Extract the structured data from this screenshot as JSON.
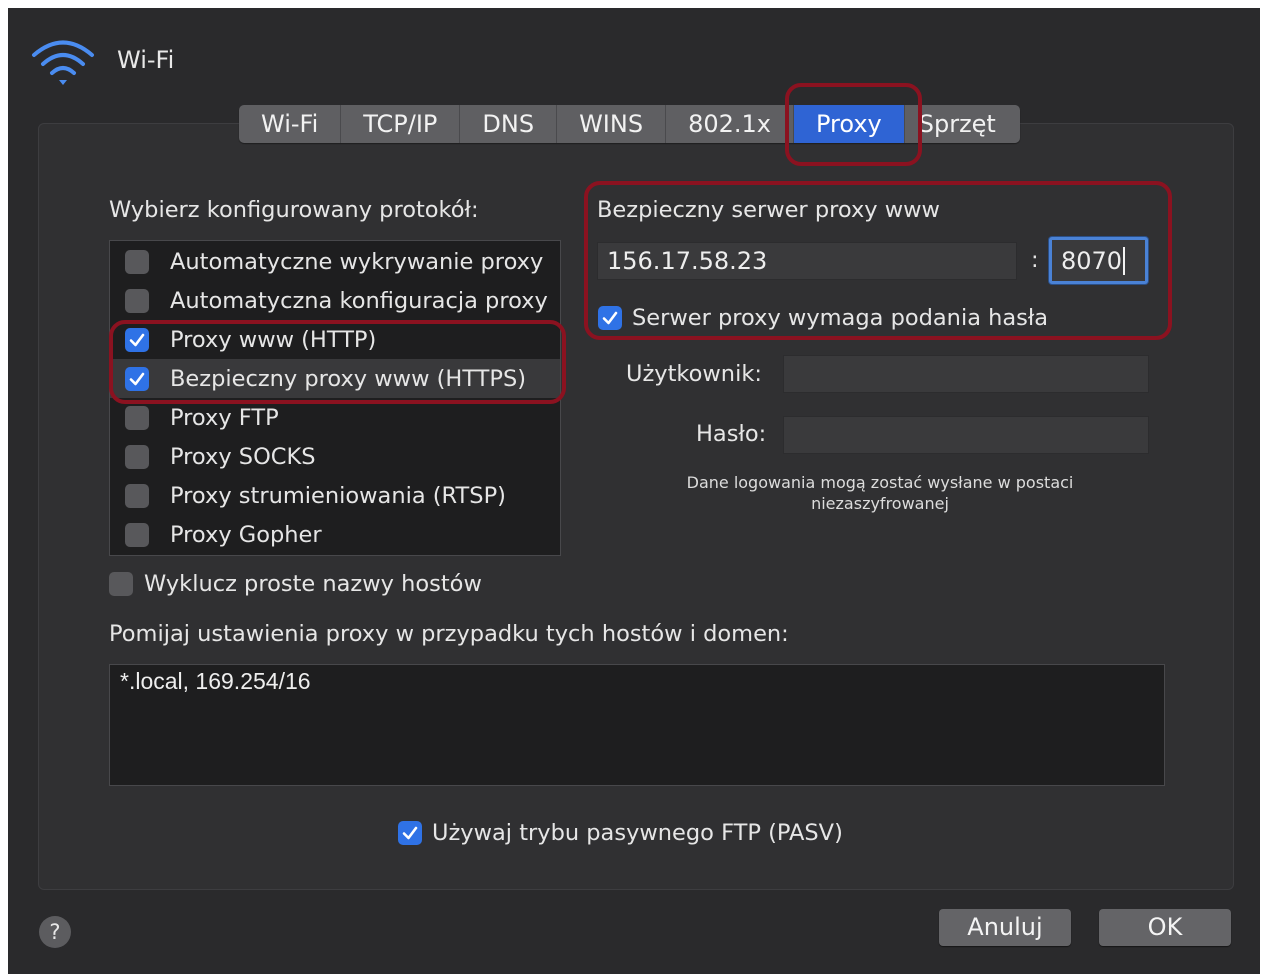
{
  "window": {
    "title": "Wi-Fi",
    "title_icon": "wifi-icon"
  },
  "tabs": [
    {
      "label": "Wi-Fi",
      "active": false
    },
    {
      "label": "TCP/IP",
      "active": false
    },
    {
      "label": "DNS",
      "active": false
    },
    {
      "label": "WINS",
      "active": false
    },
    {
      "label": "802.1x",
      "active": false
    },
    {
      "label": "Proxy",
      "active": true
    },
    {
      "label": "Sprzęt",
      "active": false
    }
  ],
  "protocols": {
    "heading": "Wybierz konfigurowany protokół:",
    "items": [
      {
        "label": "Automatyczne wykrywanie proxy",
        "checked": false
      },
      {
        "label": "Automatyczna konfiguracja proxy",
        "checked": false
      },
      {
        "label": "Proxy www (HTTP)",
        "checked": true
      },
      {
        "label": "Bezpieczny proxy www (HTTPS)",
        "checked": true
      },
      {
        "label": "Proxy FTP",
        "checked": false
      },
      {
        "label": "Proxy SOCKS",
        "checked": false
      },
      {
        "label": "Proxy strumieniowania (RTSP)",
        "checked": false
      },
      {
        "label": "Proxy Gopher",
        "checked": false
      }
    ],
    "selected_index": 3
  },
  "server": {
    "heading": "Bezpieczny serwer proxy www",
    "host": "156.17.58.23",
    "separator": ":",
    "port": "8070",
    "requires_password_label": "Serwer proxy wymaga podania hasła",
    "requires_password_checked": true
  },
  "auth": {
    "user_label": "Użytkownik:",
    "user_value": "",
    "password_label": "Hasło:",
    "password_value": "",
    "note": "Dane logowania mogą zostać wysłane w postaci niezaszyfrowanej"
  },
  "exclude_simple": {
    "label": "Wyklucz proste nazwy hostów",
    "checked": false
  },
  "bypass": {
    "label": "Pomijaj ustawienia proxy w przypadku tych hostów i domen:",
    "value": "*.local, 169.254/16"
  },
  "pasv": {
    "label": "Używaj trybu pasywnego FTP (PASV)",
    "checked": true
  },
  "buttons": {
    "help": "?",
    "cancel": "Anuluj",
    "ok": "OK"
  },
  "colors": {
    "accent": "#2f64d4",
    "checkbox_on": "#2f72e6",
    "annotation": "#8b1220",
    "window_bg": "#2a2a2c"
  }
}
